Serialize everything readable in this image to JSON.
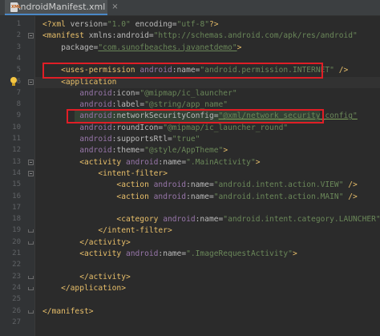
{
  "tab": {
    "filename": "AndroidManifest.xml",
    "icon": "xml-file-icon",
    "close": "×"
  },
  "colors": {
    "background": "#2b2b2b",
    "gutter": "#313335",
    "highlight_box": "#e01e26"
  },
  "lines": [
    {
      "n": "1",
      "text": "<?xml version=\"1.0\" encoding=\"utf-8\"?>"
    },
    {
      "n": "2",
      "text": "<manifest xmlns:android=\"http://schemas.android.com/apk/res/android\""
    },
    {
      "n": "3",
      "text": "    package=\"com.sunofbeaches.javanetdemo\">"
    },
    {
      "n": "4",
      "text": ""
    },
    {
      "n": "5",
      "text": "    <uses-permission android:name=\"android.permission.INTERNET\" />"
    },
    {
      "n": "6",
      "text": "    <application"
    },
    {
      "n": "7",
      "text": "        android:icon=\"@mipmap/ic_launcher\""
    },
    {
      "n": "8",
      "text": "        android:label=\"@string/app_name\""
    },
    {
      "n": "9",
      "text": "        android:networkSecurityConfig=\"@xml/network_security_config\""
    },
    {
      "n": "10",
      "text": "        android:roundIcon=\"@mipmap/ic_launcher_round\""
    },
    {
      "n": "11",
      "text": "        android:supportsRtl=\"true\""
    },
    {
      "n": "12",
      "text": "        android:theme=\"@style/AppTheme\">"
    },
    {
      "n": "13",
      "text": "        <activity android:name=\".MainActivity\">"
    },
    {
      "n": "14",
      "text": "            <intent-filter>"
    },
    {
      "n": "15",
      "text": "                <action android:name=\"android.intent.action.VIEW\" />"
    },
    {
      "n": "16",
      "text": "                <action android:name=\"android.intent.action.MAIN\" />"
    },
    {
      "n": "17",
      "text": ""
    },
    {
      "n": "18",
      "text": "                <category android:name=\"android.intent.category.LAUNCHER\" />"
    },
    {
      "n": "19",
      "text": "            </intent-filter>"
    },
    {
      "n": "20",
      "text": "        </activity>"
    },
    {
      "n": "21",
      "text": "        <activity android:name=\".ImageRequestActivity\">"
    },
    {
      "n": "22",
      "text": ""
    },
    {
      "n": "23",
      "text": "        </activity>"
    },
    {
      "n": "24",
      "text": "    </application>"
    },
    {
      "n": "25",
      "text": ""
    },
    {
      "n": "26",
      "text": "</manifest>"
    },
    {
      "n": "27",
      "text": ""
    }
  ]
}
